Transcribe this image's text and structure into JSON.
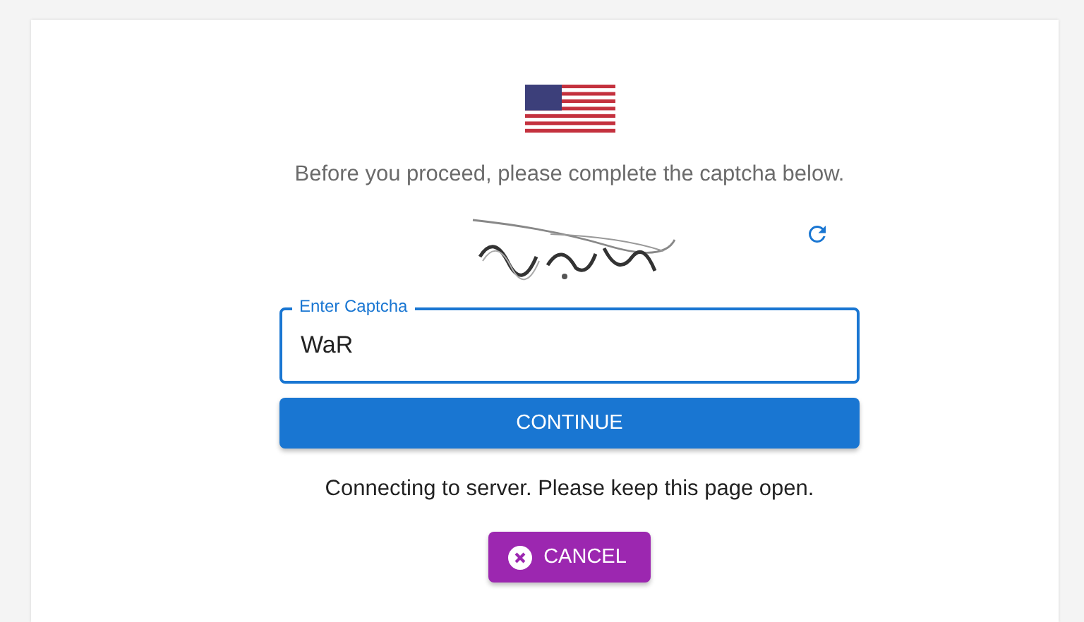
{
  "prompt": "Before you proceed, please complete the captcha below.",
  "field": {
    "label": "Enter Captcha",
    "value": "WaR",
    "focused": true
  },
  "continue_button": {
    "label": "CONTINUE"
  },
  "status": "Connecting to server. Please keep this page open.",
  "cancel_button": {
    "label": "CANCEL"
  }
}
